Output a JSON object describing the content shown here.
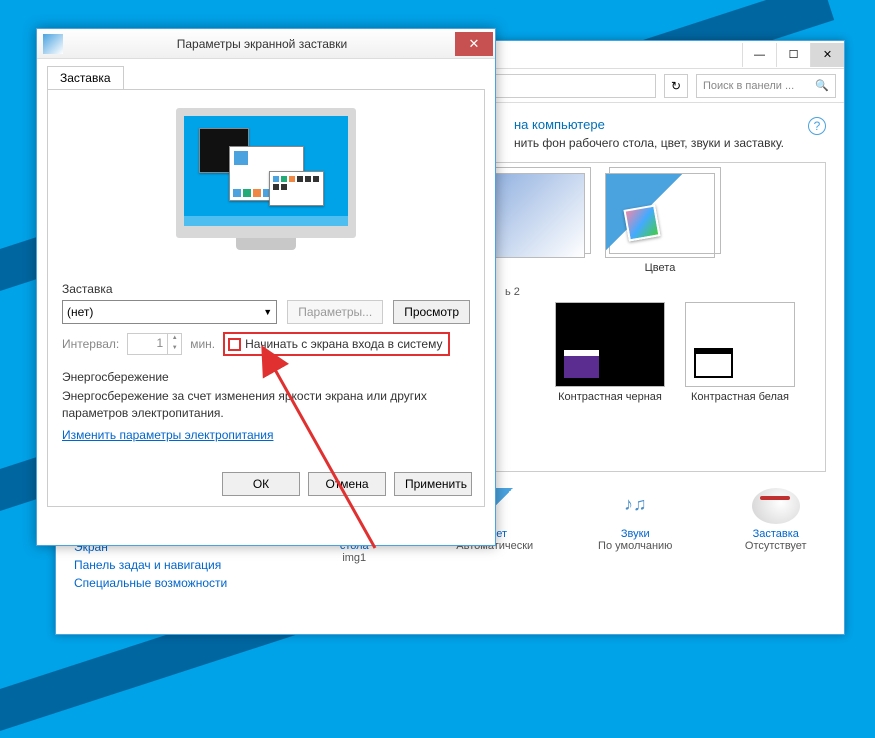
{
  "desktop": {},
  "controlPanel": {
    "titlebar": {
      "minimize": "—",
      "maximize": "☐",
      "close": "✕"
    },
    "breadcrumb_dropdown": "⌵",
    "refresh_icon": "↻",
    "search": {
      "placeholder": "Поиск в панели ...",
      "icon": "🔍"
    },
    "heading_suffix": "на компьютере",
    "subheading_suffix": "нить фон рабочего стола, цвет, звуки и заставку.",
    "help": "?",
    "themes": {
      "colors_label": "Цвета",
      "section_partial": "ь 2",
      "hc_black": "Контрастная черная",
      "hc_white": "Контрастная белая"
    },
    "bottom": {
      "wallpaper_label": "Фон рабочего стола",
      "wallpaper_value": "img1",
      "color_label": "Цвет",
      "color_value": "Автоматически",
      "sound_label": "Звуки",
      "sound_value": "По умолчанию",
      "screensaver_label": "Заставка",
      "screensaver_value": "Отсутствует"
    },
    "sidebar": {
      "screen": "Экран",
      "taskbar": "Панель задач и навигация",
      "accessibility": "Специальные возможности"
    }
  },
  "screensaver": {
    "title": "Параметры экранной заставки",
    "close": "✕",
    "tab": "Заставка",
    "section_label": "Заставка",
    "select_value": "(нет)",
    "btn_params": "Параметры...",
    "btn_preview": "Просмотр",
    "interval_label": "Интервал:",
    "interval_value": "1",
    "interval_unit": "мин.",
    "checkbox_label": "Начинать с экрана входа в систему",
    "energy_title": "Энергосбережение",
    "energy_text": "Энергосбережение за счет изменения яркости экрана или других параметров электропитания.",
    "energy_link": "Изменить параметры электропитания",
    "btn_ok": "ОК",
    "btn_cancel": "Отмена",
    "btn_apply": "Применить"
  }
}
